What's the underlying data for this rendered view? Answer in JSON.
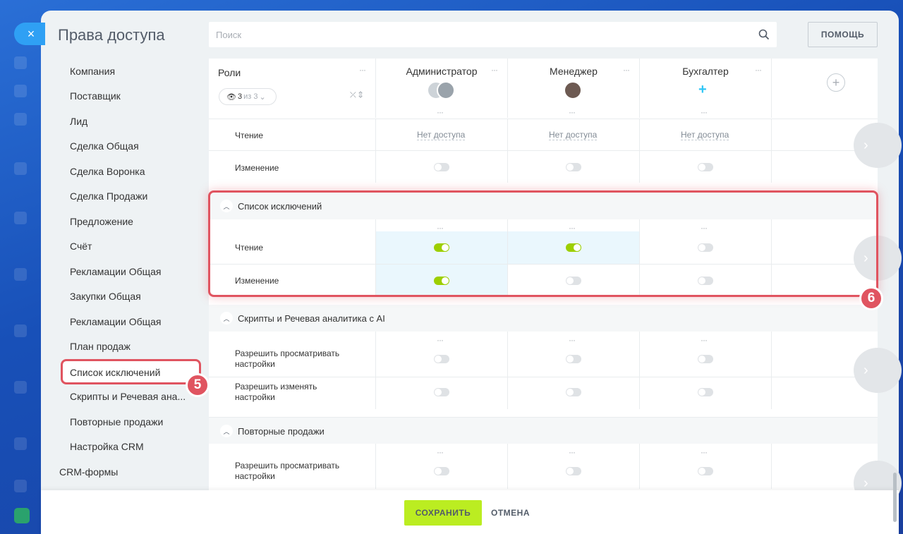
{
  "window": {
    "title": "Права доступа",
    "close_icon": "×"
  },
  "search": {
    "placeholder": "Поиск"
  },
  "help_button": "ПОМОЩЬ",
  "sidebar": {
    "items": [
      "Компания",
      "Поставщик",
      "Лид",
      "Сделка Общая",
      "Сделка Воронка",
      "Сделка Продажи",
      "Предложение",
      "Счёт",
      "Рекламации Общая",
      "Закупки Общая",
      "Рекламации Общая",
      "План продаж",
      "Список исключений",
      "Скрипты и Речевая ана...",
      "Повторные продажи",
      "Настройка CRM"
    ],
    "selected": "Список исключений",
    "top_item": "CRM-формы"
  },
  "table": {
    "roles_label": "Роли",
    "counter": {
      "value": "3",
      "of": "из 3"
    },
    "roles": [
      "Администратор",
      "Менеджер",
      "Бухгалтер"
    ],
    "more_icon": "···",
    "rows_top": [
      {
        "label": "Чтение",
        "values": [
          "Нет доступа",
          "Нет доступа",
          "Нет доступа"
        ]
      },
      {
        "label": "Изменение",
        "toggles": [
          false,
          false,
          false
        ]
      }
    ],
    "sections": [
      {
        "title": "Список исключений",
        "rows": [
          {
            "label": "Чтение",
            "toggles": [
              true,
              true,
              false
            ]
          },
          {
            "label": "Изменение",
            "toggles": [
              true,
              false,
              false
            ]
          }
        ]
      },
      {
        "title": "Скрипты и Речевая аналитика с AI",
        "rows": [
          {
            "label_line1": "Разрешить просматривать",
            "label_line2": "настройки",
            "toggles": [
              false,
              false,
              false
            ]
          },
          {
            "label_line1": "Разрешить изменять",
            "label_line2": "настройки",
            "toggles": [
              false,
              false,
              false
            ]
          }
        ]
      },
      {
        "title": "Повторные продажи",
        "rows": [
          {
            "label_line1": "Разрешить просматривать",
            "label_line2": "настройки",
            "toggles": [
              false,
              false,
              false
            ]
          }
        ]
      }
    ]
  },
  "annotations": {
    "badge_5": "5",
    "badge_6": "6"
  },
  "footer": {
    "save": "СОХРАНИТЬ",
    "cancel": "ОТМЕНА"
  },
  "colors": {
    "accent_green": "#bbed21",
    "toggle_on": "#9dcf00",
    "highlight": "#e05460",
    "close_blue": "#2fa0f4"
  }
}
